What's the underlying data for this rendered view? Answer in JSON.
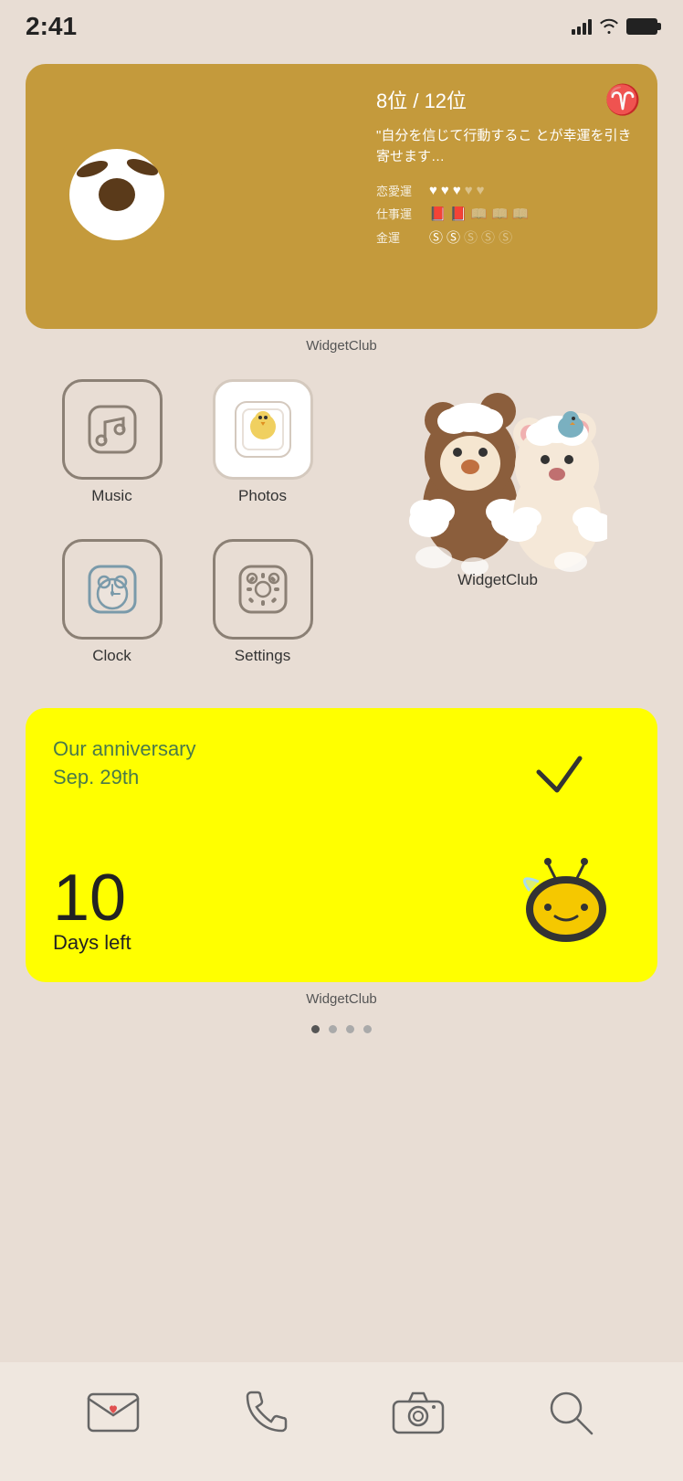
{
  "statusBar": {
    "time": "2:41"
  },
  "horoscopeWidget": {
    "rank": "8位 / 12位",
    "zodiac": "♈",
    "quote": "\"自分を信じて行動するこ とが幸運を引き寄せます…",
    "ratings": [
      {
        "label": "恋愛運",
        "filled": 3,
        "total": 5,
        "icon": "♥"
      },
      {
        "label": "仕事運",
        "filled": 2,
        "total": 5,
        "icon": "📖"
      },
      {
        "label": "金運",
        "filled": 2,
        "total": 5,
        "icon": "Ⓢ"
      }
    ],
    "widgetLabel": "WidgetClub"
  },
  "apps": [
    {
      "id": "music",
      "label": "Music"
    },
    {
      "id": "photos",
      "label": "Photos"
    },
    {
      "id": "clock",
      "label": "Clock"
    },
    {
      "id": "settings",
      "label": "Settings"
    },
    {
      "id": "widgetclub",
      "label": "WidgetClub"
    }
  ],
  "anniversaryWidget": {
    "title": "Our anniversary\nSep. 29th",
    "daysNumber": "10",
    "daysLabel": "Days left",
    "widgetLabel": "WidgetClub"
  },
  "pageDots": {
    "total": 4,
    "active": 0
  },
  "dock": {
    "items": [
      "mail",
      "phone",
      "camera",
      "search"
    ]
  }
}
